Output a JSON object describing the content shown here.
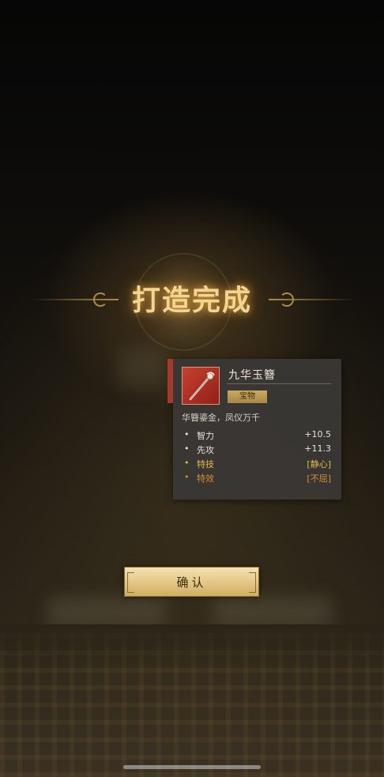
{
  "title": "打造完成",
  "item": {
    "name": "九华玉簪",
    "rarity": "宝物",
    "description": "华簪鎏金，凤仪万千",
    "stats": [
      {
        "name": "智力",
        "value": "+10.5",
        "style": "white"
      },
      {
        "name": "先攻",
        "value": "+11.3",
        "style": "white"
      },
      {
        "name": "特技",
        "value": "[静心]",
        "style": "gold"
      },
      {
        "name": "特效",
        "value": "[不屈]",
        "style": "orange"
      }
    ]
  },
  "confirm_label": "确认",
  "colors": {
    "title_gold": "#f2d591",
    "rarity_gold": "#c9a964",
    "skill_gold": "#e6b84a",
    "effect_orange": "#d98a3a",
    "item_red": "#a5392c"
  },
  "icons": {
    "item": "hairpin-icon"
  }
}
